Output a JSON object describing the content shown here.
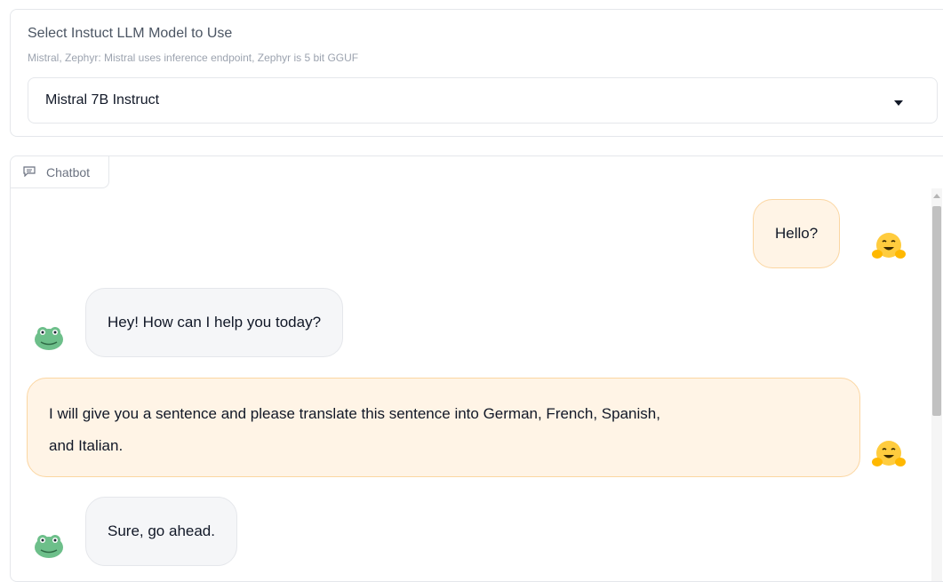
{
  "model_selector": {
    "label": "Select Instuct LLM Model to Use",
    "info": "Mistral, Zephyr: Mistral uses inference endpoint, Zephyr is 5 bit GGUF",
    "selected_value": "Mistral 7B Instruct"
  },
  "chatbot": {
    "tab_label": "Chatbot",
    "messages": [
      {
        "role": "user",
        "text": "Hello?",
        "avatar": "hugging-face-emoji"
      },
      {
        "role": "bot",
        "text": "Hey! How can I help you today?",
        "avatar": "frog-avatar"
      },
      {
        "role": "user",
        "text_line_1": "I will give you a sentence and please translate this sentence into German, French, Spanish,",
        "text_line_2": "and Italian.",
        "avatar": "hugging-face-emoji"
      },
      {
        "role": "bot",
        "text": "Sure, go ahead.",
        "avatar": "frog-avatar"
      }
    ]
  },
  "colors": {
    "user_bubble": "#fff4e6",
    "user_bubble_border": "#fbd6a2",
    "bot_bubble": "#f5f6f8",
    "frog_green": "#6dbf8a",
    "hug_yellow": "#ffcc3e"
  }
}
